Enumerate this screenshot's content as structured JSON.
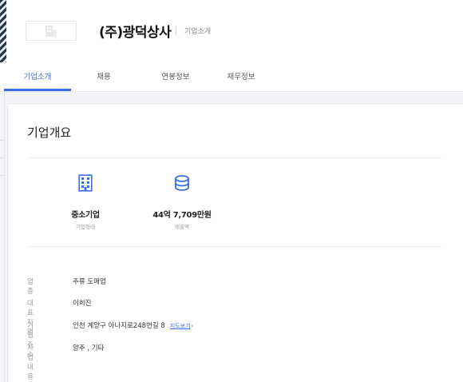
{
  "company": {
    "name": "(주)광덕상사",
    "page_title": "기업소개"
  },
  "tabs": [
    {
      "label": "기업소개",
      "active": true
    },
    {
      "label": "채용",
      "active": false
    },
    {
      "label": "연봉정보",
      "active": false
    },
    {
      "label": "재무정보",
      "active": false
    }
  ],
  "overview": {
    "title": "기업개요",
    "stats": [
      {
        "icon": "building-icon",
        "value": "중소기업",
        "label": "기업형태"
      },
      {
        "icon": "coin-stack-icon",
        "value": "44억 7,709만원",
        "label": "매출액"
      }
    ],
    "details": [
      {
        "label": "업종",
        "value": "주류 도매업"
      },
      {
        "label": "대표자명",
        "value": "이희진"
      },
      {
        "label": "기업주소",
        "value": "인천 계양구 아나지로248번길 8",
        "link": "지도보기",
        "link_icon": "›"
      },
      {
        "label": "사업내용",
        "value": "양주 , 기타"
      }
    ]
  },
  "colors": {
    "accent": "#3a6ee8",
    "page_bg": "#f3f4f7",
    "muted_text": "#9a9da3"
  }
}
